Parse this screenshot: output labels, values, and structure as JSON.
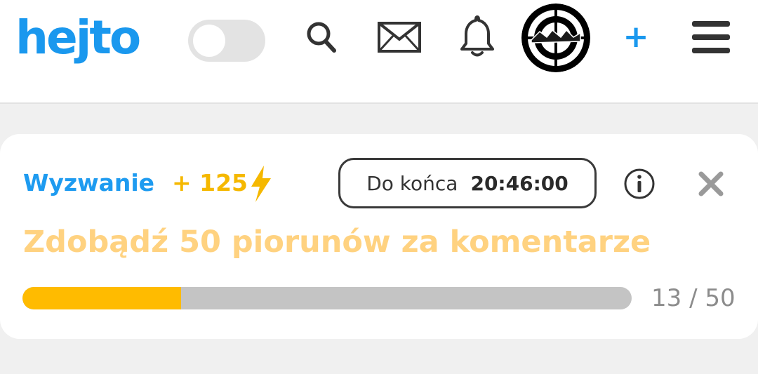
{
  "header": {
    "logo_text": "hejto",
    "dark_mode_toggle": "off",
    "icons": [
      "search-icon",
      "mail-icon",
      "bell-icon",
      "avatar",
      "plus-icon",
      "menu-icon"
    ],
    "add_label": "+",
    "accent_color": "#1a98ee"
  },
  "challenge": {
    "label": "Wyzwanie",
    "reward": "+ 125",
    "reward_icon": "lightning-icon",
    "timer_label": "Do końca",
    "timer_value": "20:46:00",
    "title": "Zdobądź 50 piorunów za komentarze",
    "progress_current": 13,
    "progress_total": 50,
    "progress_text": "13 / 50",
    "colors": {
      "label": "#1e9bf0",
      "reward": "#f5b800",
      "title": "#ffd280",
      "bar_fill": "#ffbb00",
      "bar_track": "#c4c4c4"
    }
  }
}
